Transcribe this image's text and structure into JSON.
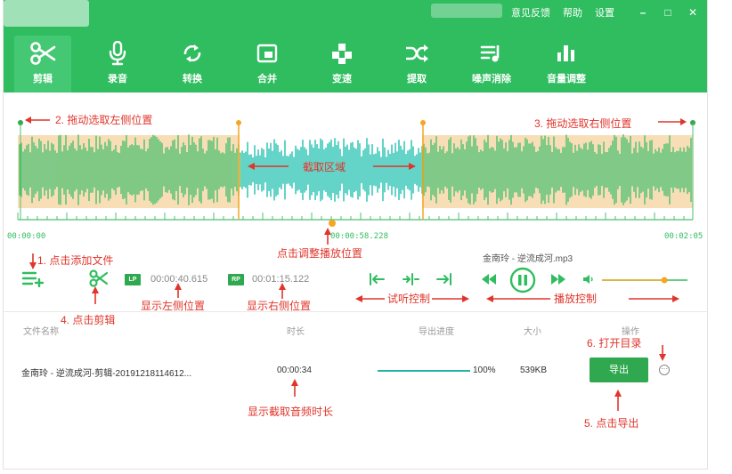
{
  "header": {
    "menu": {
      "feedback": "意见反馈",
      "help": "帮助",
      "settings": "设置"
    },
    "window": {
      "minimize": "–",
      "maximize": "□",
      "close": "✕"
    },
    "tabs": [
      {
        "label": "剪辑",
        "icon": "scissors-icon",
        "active": true
      },
      {
        "label": "录音",
        "icon": "microphone-icon",
        "active": false
      },
      {
        "label": "转换",
        "icon": "convert-icon",
        "active": false
      },
      {
        "label": "合并",
        "icon": "merge-icon",
        "active": false
      },
      {
        "label": "变速",
        "icon": "speed-icon",
        "active": false
      },
      {
        "label": "提取",
        "icon": "extract-icon",
        "active": false
      },
      {
        "label": "噪声消除",
        "icon": "noise-removal-icon",
        "active": false
      },
      {
        "label": "音量调整",
        "icon": "volume-adjust-icon",
        "active": false
      }
    ]
  },
  "waveform": {
    "time_start": "00:00:00",
    "time_current": "00:00:58.228",
    "time_end": "00:02:05",
    "selection_label": "截取区域"
  },
  "controls": {
    "lp_badge": "LP",
    "lp_time": "00:00:40.615",
    "rp_badge": "RP",
    "rp_time": "00:01:15.122",
    "filename": "金南玲 - 逆流成河.mp3",
    "volume_level": 0.73
  },
  "table": {
    "headers": {
      "name": "文件名称",
      "duration": "时长",
      "progress": "导出进度",
      "size": "大小",
      "action": "操作"
    },
    "row": {
      "name": "金南玲 - 逆流成河-剪辑-20191218114612...",
      "duration": "00:00:34",
      "progress_pct": "100%",
      "progress": 1.0,
      "size": "539KB",
      "export_label": "导出"
    }
  },
  "annotations": {
    "drag_left": "2. 拖动选取左侧位置",
    "drag_right": "3. 拖动选取右侧位置",
    "adjust_play": "点击调整播放位置",
    "add_file": "1. 点击添加文件",
    "show_left": "显示左侧位置",
    "show_right": "显示右侧位置",
    "click_cut": "4. 点击剪辑",
    "preview_ctrl": "试听控制",
    "play_ctrl": "播放控制",
    "open_dir": "6. 打开目录",
    "show_duration": "显示截取音频时长",
    "click_export": "5. 点击导出"
  },
  "colors": {
    "brand": "#2fbd5f",
    "selection": "#f8deb7",
    "wave_out": "#4cc070",
    "wave_in": "#22c1b0",
    "handle": "#f5a623",
    "annotation": "#e0352b"
  }
}
